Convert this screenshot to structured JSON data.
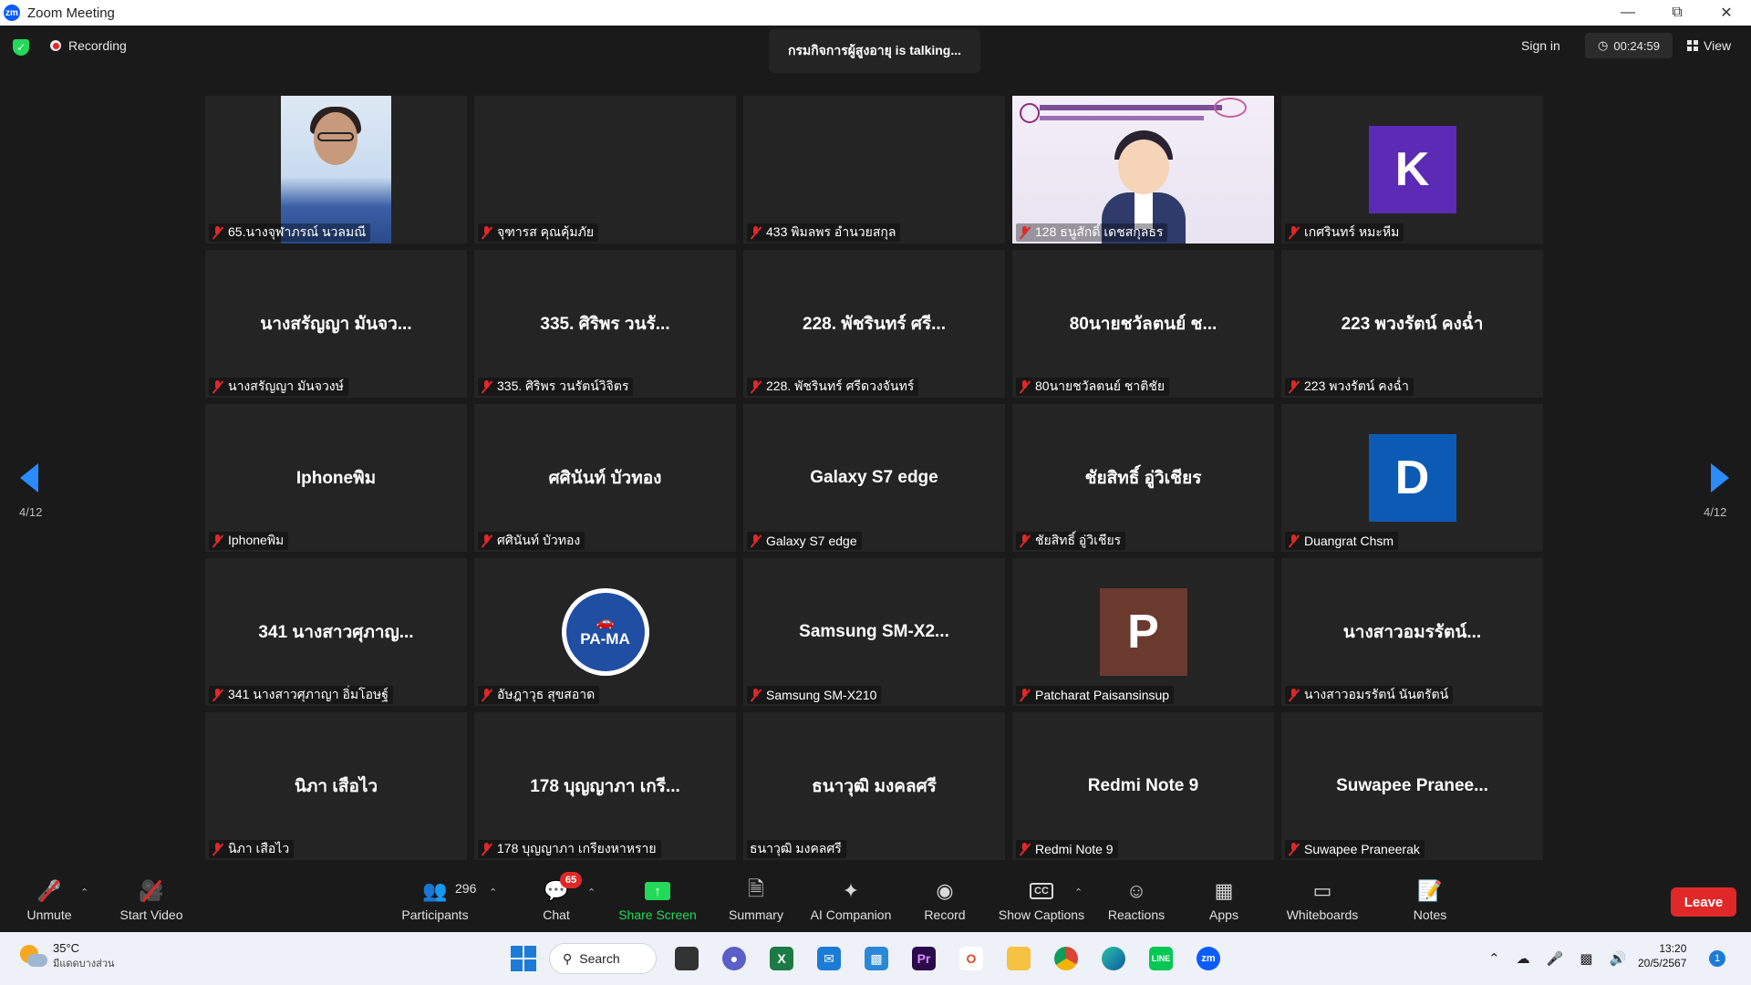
{
  "window": {
    "title": "Zoom Meeting",
    "app_icon": "zm",
    "controls": [
      "minimize",
      "restore",
      "close"
    ]
  },
  "topbar": {
    "recording_label": "Recording",
    "talking_label": "กรมกิจการผู้สูงอายุ is talking...",
    "sign_in_label": "Sign in",
    "timer": "00:24:59",
    "view_label": "View"
  },
  "gallery": {
    "page_left": "4/12",
    "page_right": "4/12",
    "tiles": [
      {
        "display": "",
        "name": "65.นางจุฬาภรณ์ นวลมณี",
        "kind": "video-person"
      },
      {
        "display": "",
        "name": "จุฑารส คุณคุ้มภัย",
        "kind": "blank"
      },
      {
        "display": "",
        "name": "433 พิมลพร อำนวยสกุล",
        "kind": "blank"
      },
      {
        "display": "",
        "name": "128 ธนูสักดิ์ เดชสกุลธร",
        "kind": "video-cartoon"
      },
      {
        "display": "K",
        "name": "เกศรินทร์ หมะหีม",
        "kind": "avatar",
        "color": "#5b2bb5"
      },
      {
        "display": "นางสรัญญา มันจว...",
        "name": "นางสรัญญา มันจวงษ์",
        "kind": "text"
      },
      {
        "display": "335. ศิริพร   วนรั...",
        "name": "335.  ศิริพร   วนรัตน์วิจิตร",
        "kind": "text"
      },
      {
        "display": "228. พัชรินทร์ ศรี...",
        "name": "228. พัชรินทร์ ศรีดวงจันทร์",
        "kind": "text"
      },
      {
        "display": "80นายชวัลตนย์ ช...",
        "name": "80นายชวัลตนย์ ชาติชัย",
        "kind": "text"
      },
      {
        "display": "223 พวงรัตน์  คงฉ่ำ",
        "name": "223 พวงรัตน์  คงฉ่ำ",
        "kind": "text"
      },
      {
        "display": "Iphoneพิม",
        "name": "Iphoneพิม",
        "kind": "text"
      },
      {
        "display": "ศศินันท์ บัวทอง",
        "name": "ศศินันท์ บัวทอง",
        "kind": "text"
      },
      {
        "display": "Galaxy S7 edge",
        "name": "Galaxy S7 edge",
        "kind": "text"
      },
      {
        "display": "ชัยสิทธิ์ อู่วิเชียร",
        "name": "ชัยสิทธิ์ อู่วิเชียร",
        "kind": "text"
      },
      {
        "display": "D",
        "name": "Duangrat Chsm",
        "kind": "avatar",
        "color": "#0b5bb5"
      },
      {
        "display": "341 นางสาวศุภาญ...",
        "name": "341 นางสาวศุภาญา อิ่มโอษฐ์",
        "kind": "text"
      },
      {
        "display": "PA-MA",
        "name": "อัษฎาวุธ สุขสอาด",
        "kind": "logo"
      },
      {
        "display": "Samsung  SM-X2...",
        "name": "Samsung SM-X210",
        "kind": "text"
      },
      {
        "display": "P",
        "name": "Patcharat Paisansinsup",
        "kind": "avatar",
        "color": "#6b3a2e"
      },
      {
        "display": "นางสาวอมรรัตน์...",
        "name": "นางสาวอมรรัตน์ นันตรัตน์",
        "kind": "text"
      },
      {
        "display": "นิภา เสือไว",
        "name": "นิภา เสือไว",
        "kind": "text"
      },
      {
        "display": "178 บุญญาภา เกรี...",
        "name": "178 บุญญาภา เกรียงหาหราย",
        "kind": "text"
      },
      {
        "display": "ธนาวุฒิ มงคลศรี",
        "name": "ธนาวุฒิ มงคลศรี",
        "kind": "text",
        "unmuted": true
      },
      {
        "display": "Redmi Note 9",
        "name": "Redmi Note 9",
        "kind": "text"
      },
      {
        "display": "Suwapee  Pranee...",
        "name": "Suwapee Praneerak",
        "kind": "text"
      }
    ]
  },
  "toolbar": {
    "unmute": "Unmute",
    "start_video": "Start Video",
    "participants": "Participants",
    "participant_count": "296",
    "chat": "Chat",
    "chat_badge": "65",
    "share_screen": "Share Screen",
    "summary": "Summary",
    "ai_companion": "AI Companion",
    "record": "Record",
    "show_captions": "Show Captions",
    "reactions": "Reactions",
    "apps": "Apps",
    "whiteboards": "Whiteboards",
    "notes": "Notes",
    "leave": "Leave"
  },
  "taskbar": {
    "temperature": "35°C",
    "weather_desc": "มีแดดบางส่วน",
    "search_label": "Search",
    "time": "13:20",
    "date": "20/5/2567",
    "notification_count": "1"
  }
}
